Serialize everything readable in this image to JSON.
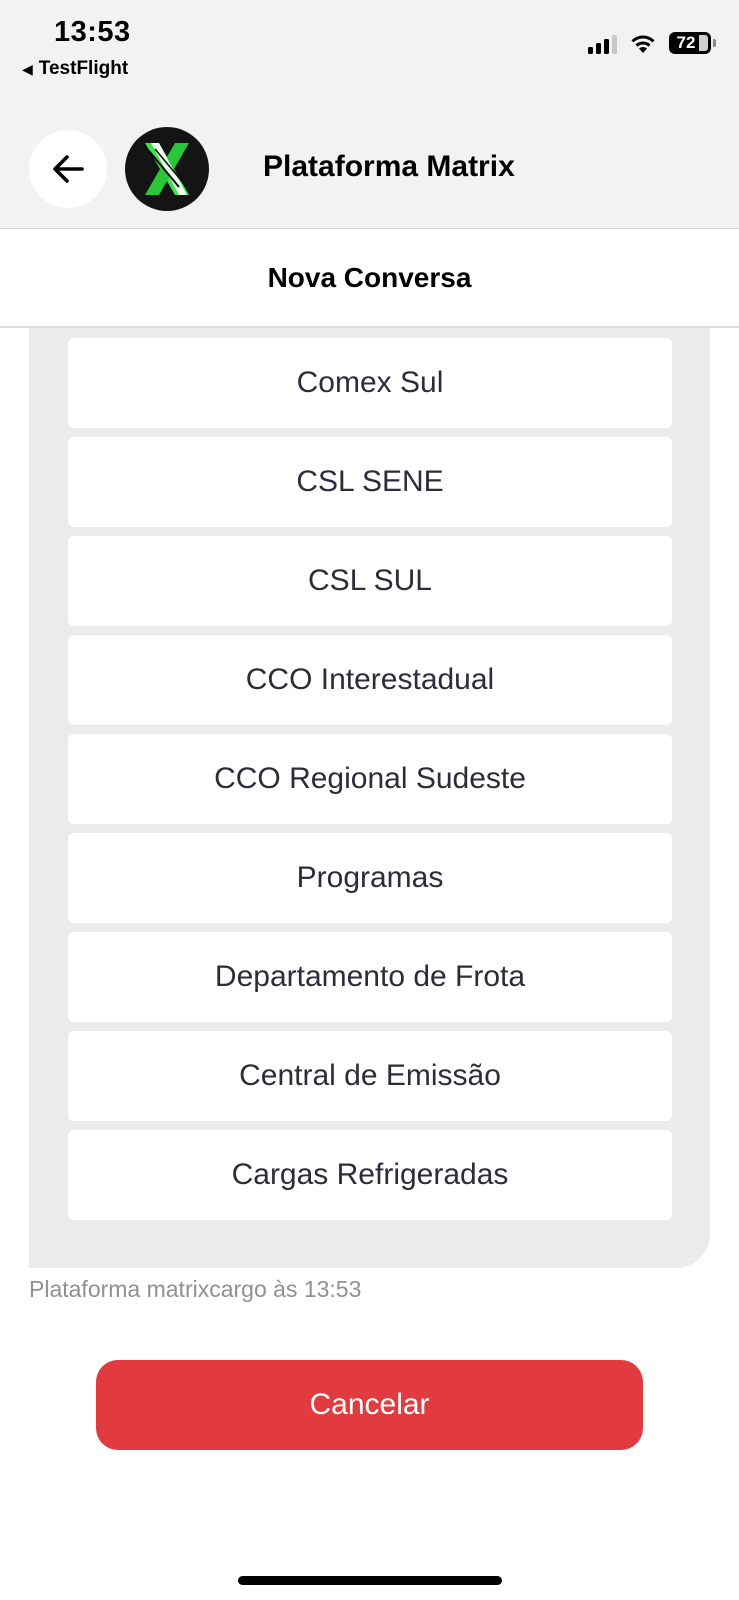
{
  "status_bar": {
    "time": "13:53",
    "back_app": "TestFlight",
    "back_app_icon": "triangle-left-icon",
    "battery": "72"
  },
  "header": {
    "title": "Plataforma Matrix",
    "back_icon": "arrow-left-icon",
    "logo_icon": "matrix-x-logo"
  },
  "subheader": {
    "title": "Nova Conversa"
  },
  "options": [
    {
      "label": "Comex Sul"
    },
    {
      "label": "CSL SENE"
    },
    {
      "label": "CSL SUL"
    },
    {
      "label": "CCO Interestadual"
    },
    {
      "label": "CCO Regional Sudeste"
    },
    {
      "label": "Programas"
    },
    {
      "label": "Departamento de Frota"
    },
    {
      "label": "Central de Emissão"
    },
    {
      "label": "Cargas Refrigeradas"
    }
  ],
  "message_meta": "Plataforma matrixcargo às 13:53",
  "cancel_label": "Cancelar",
  "colors": {
    "accent_red": "#e23b3f",
    "logo_green": "#3ee24a",
    "header_bg": "#f2f2f4",
    "panel_bg": "#ebebeb"
  }
}
